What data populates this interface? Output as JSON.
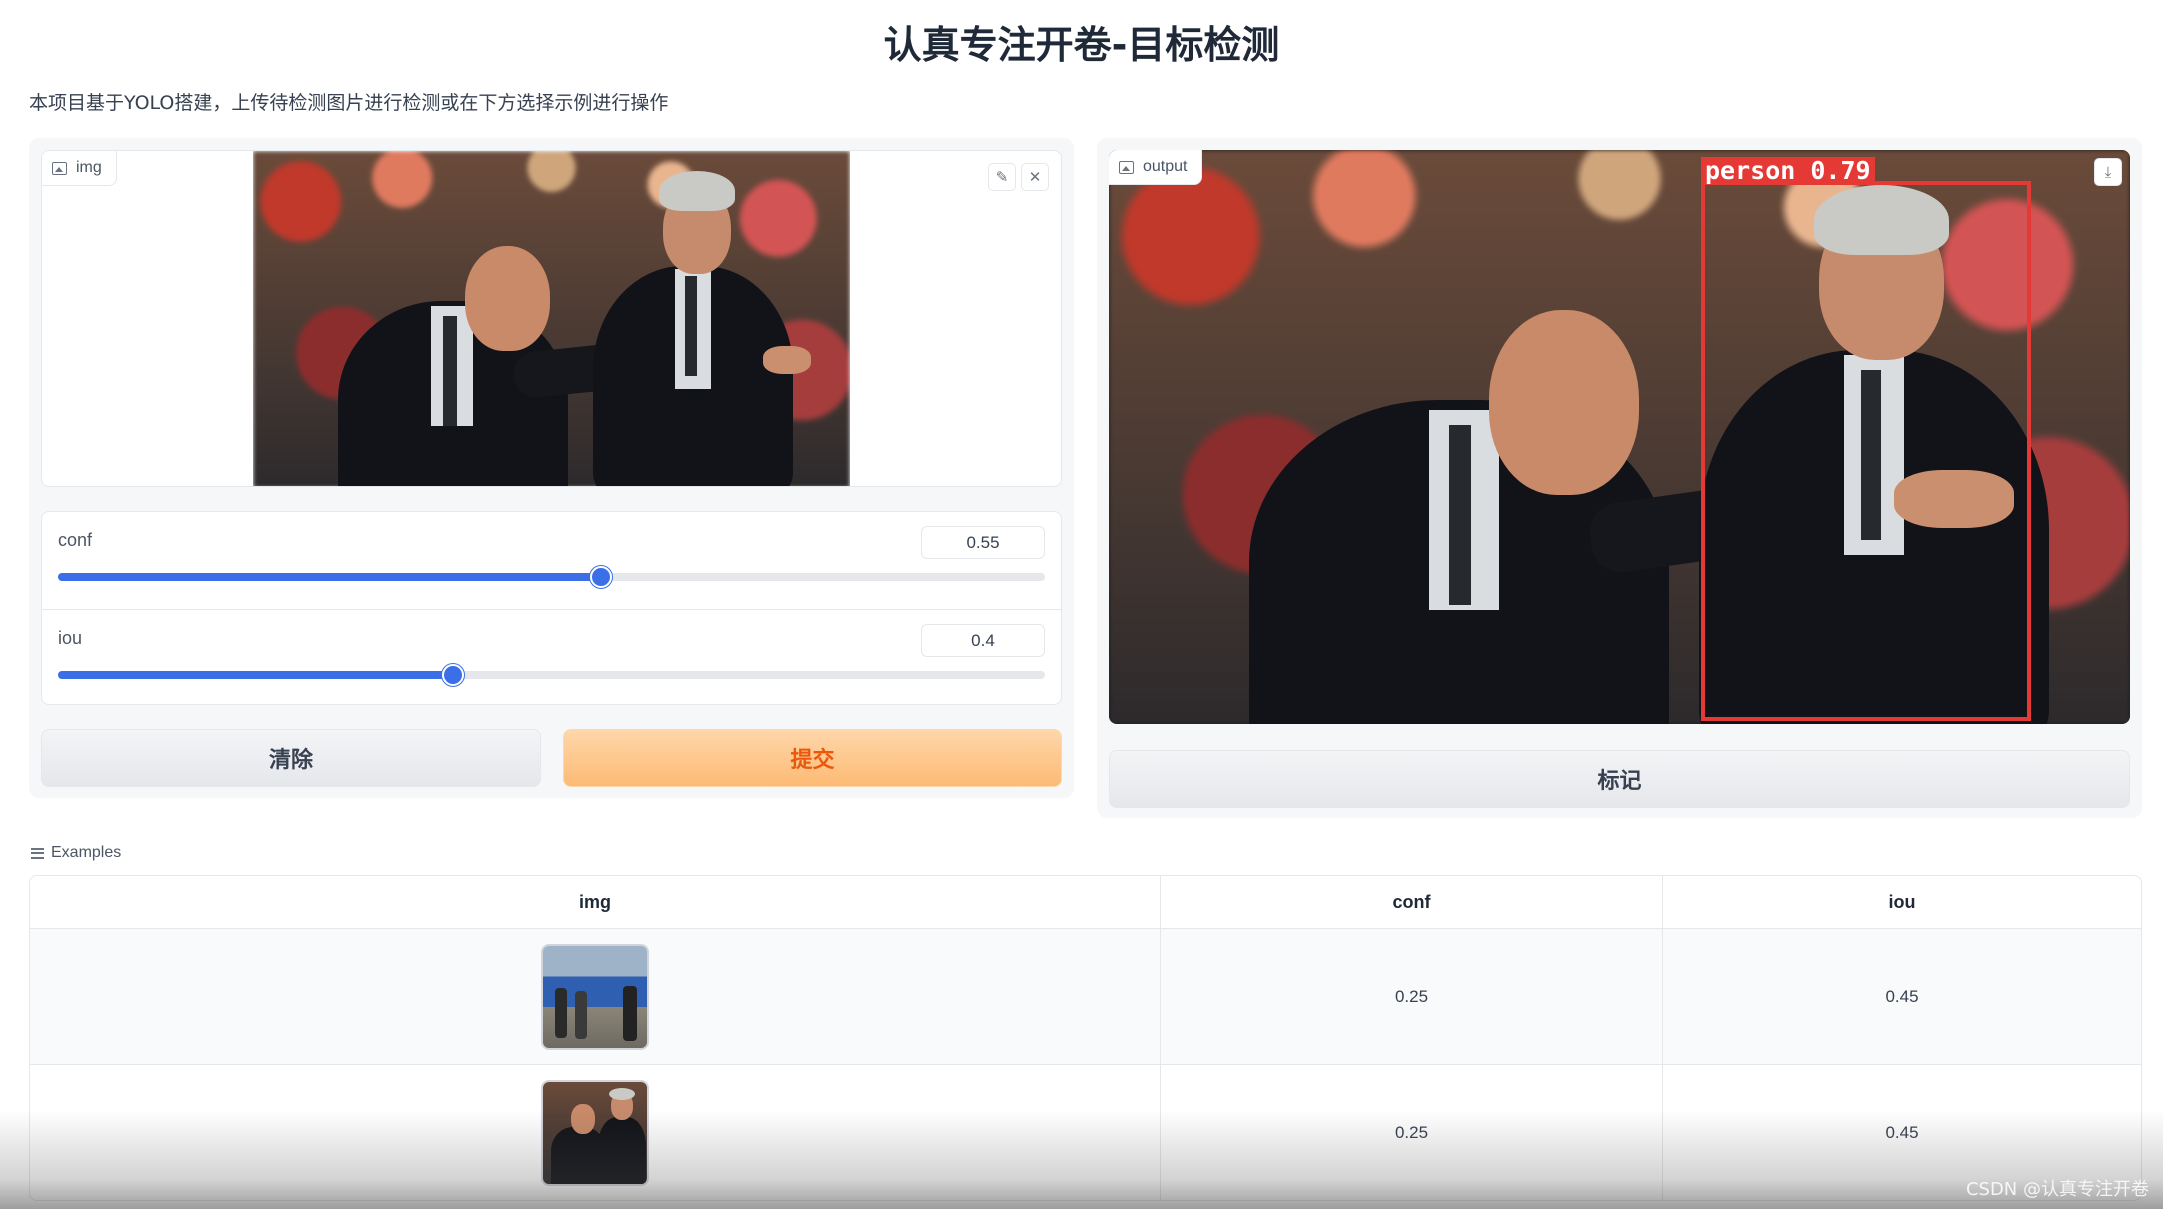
{
  "page": {
    "title": "认真专注开卷-目标检测",
    "description": "本项目基于YOLO搭建，上传待检测图片进行检测或在下方选择示例进行操作"
  },
  "input": {
    "img_label": "img",
    "edit_icon": "✎",
    "close_icon": "✕"
  },
  "sliders": {
    "conf": {
      "label": "conf",
      "value": "0.55",
      "fraction": 0.55
    },
    "iou": {
      "label": "iou",
      "value": "0.4",
      "fraction": 0.4
    }
  },
  "buttons": {
    "clear": "清除",
    "submit": "提交",
    "mark": "标记"
  },
  "output": {
    "label": "output",
    "download_icon": "⤓",
    "detection_label": "person  0.79"
  },
  "examples": {
    "label": "Examples",
    "headers": [
      "img",
      "conf",
      "iou"
    ],
    "rows": [
      {
        "conf": "0.25",
        "iou": "0.45"
      },
      {
        "conf": "0.25",
        "iou": "0.45"
      }
    ]
  },
  "watermark": "CSDN @认真专注开卷",
  "colors": {
    "accent": "#3b6fe8",
    "submit_bg": "#fdba74",
    "submit_text": "#ea580c",
    "bbox": "#e53935"
  }
}
